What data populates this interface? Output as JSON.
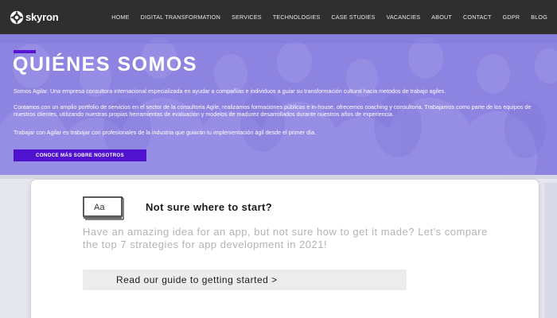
{
  "brand": {
    "name": "skyron"
  },
  "nav": {
    "items": [
      {
        "label": "HOME"
      },
      {
        "label": "DIGITAL TRANSFORMATION"
      },
      {
        "label": "SERVICES"
      },
      {
        "label": "TECHNOLOGIES"
      },
      {
        "label": "CASE STUDIES"
      },
      {
        "label": "VACANCIES"
      },
      {
        "label": "ABOUT"
      },
      {
        "label": "CONTACT"
      },
      {
        "label": "GDPR"
      },
      {
        "label": "BLOG"
      }
    ]
  },
  "hero": {
    "title": "QUIÉNES SOMOS",
    "paragraph1": "Somos Agilar. Una empresa consultora internacional especializada en ayudar a compañías e individuos a guiar su transformación cultural hacia metodos de trabajo agiles.",
    "paragraph2": "Contamos con un amplio portfolio de servicios en el sector de la consultoria Agile, realizamos formaciones públicas e in-house, ofrecemos coaching y consultoria. Trabajamos como parte de los equipos de nuestros clientes, utilizando nuestras propias herramientas de evaluación y modelos de madurez desarrollados durante nuestros años de experiencia.",
    "paragraph3": "Trabajar con Agilar es trabajar con profesionales de la industria que guiarán tu implementación ágil desde el primer día.",
    "button_label": "CONOCE MÁS SOBRE NOSOTROS"
  },
  "card": {
    "icon_label": "Aa",
    "title": "Not sure where to start?",
    "body": "Have an amazing idea for an app, but not sure how to get it made? Let's compare the top 7 strategies for app development in 2021!",
    "button_label": "Read our guide to getting started >"
  },
  "colors": {
    "nav_bg": "#2f2f2f",
    "accent": "#4f12cf",
    "hero_tint": "#9b93e3"
  }
}
